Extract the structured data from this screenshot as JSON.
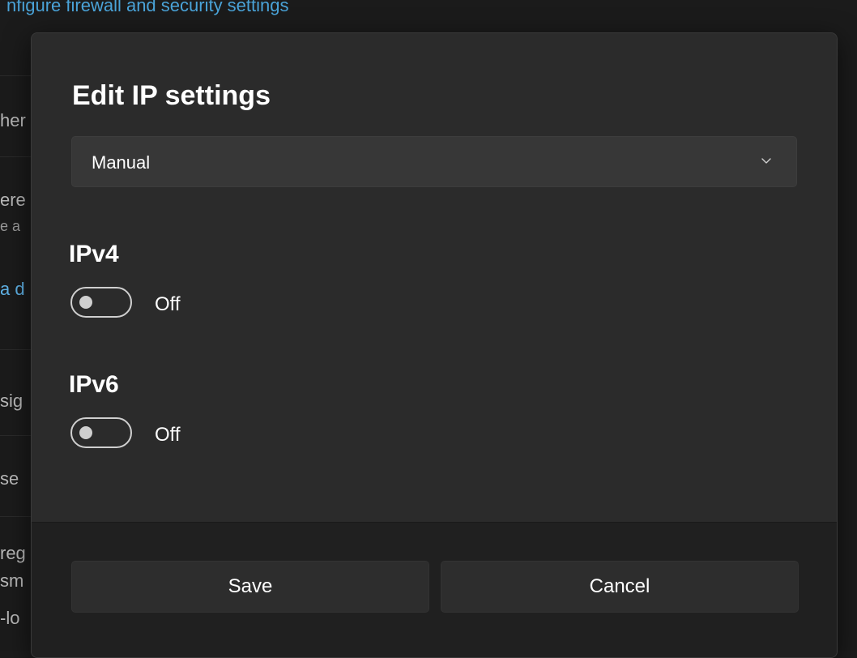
{
  "background": {
    "top_link": "nfigure firewall and security settings",
    "fragments": [
      {
        "text": "her"
      },
      {
        "text": "ere"
      },
      {
        "text": "e a"
      },
      {
        "text": "a d"
      },
      {
        "text": "sig"
      },
      {
        "text": "se"
      },
      {
        "text": "reg"
      },
      {
        "text": "sm"
      },
      {
        "text": "-lo"
      }
    ]
  },
  "dialog": {
    "title": "Edit IP settings",
    "mode_dropdown": {
      "selected": "Manual"
    },
    "ipv4": {
      "label": "IPv4",
      "toggle_state": "Off"
    },
    "ipv6": {
      "label": "IPv6",
      "toggle_state": "Off"
    },
    "buttons": {
      "save": "Save",
      "cancel": "Cancel"
    }
  },
  "colors": {
    "dialog_bg": "#2b2b2b",
    "footer_bg": "#202020",
    "link": "#4aa3d8",
    "toggle_off": "#cfcfcf"
  }
}
